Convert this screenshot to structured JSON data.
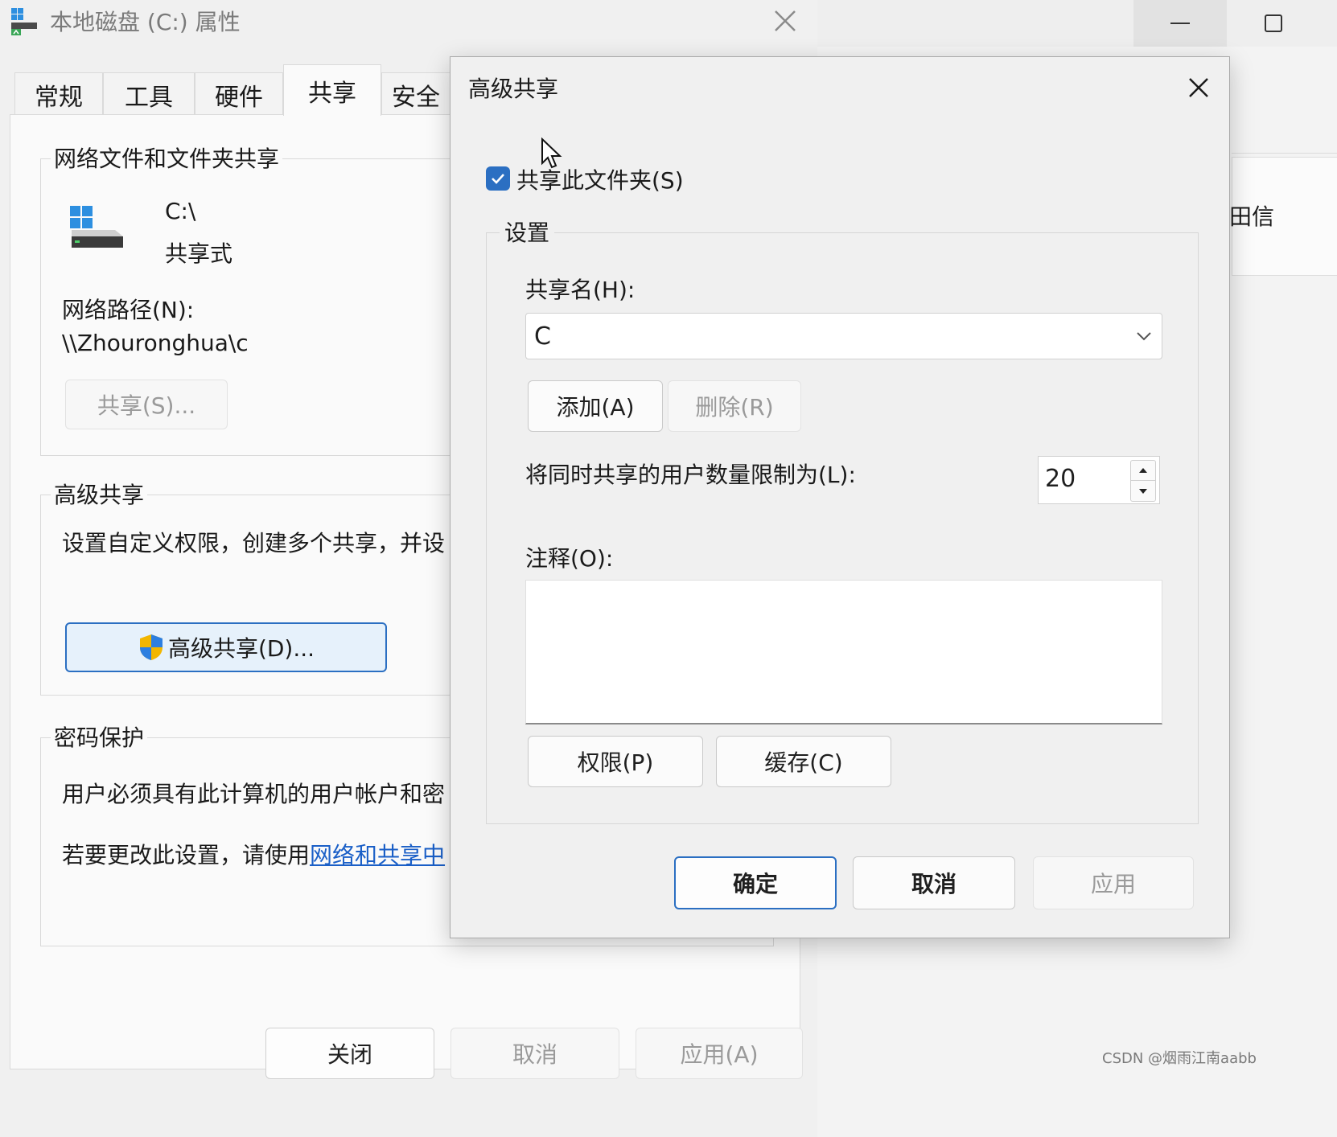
{
  "properties_window": {
    "title": "本地磁盘 (C:) 属性",
    "tabs": [
      {
        "label": "常规"
      },
      {
        "label": "工具"
      },
      {
        "label": "硬件"
      },
      {
        "label": "共享",
        "active": true
      },
      {
        "label": "安全"
      }
    ],
    "network_sharing": {
      "group_title": "网络文件和文件夹共享",
      "drive_name": "C:\\",
      "status": "共享式",
      "network_path_label": "网络路径(N):",
      "network_path_value": "\\\\Zhouronghua\\c",
      "share_button": "共享(S)..."
    },
    "advanced_sharing_group": {
      "group_title": "高级共享",
      "description": "设置自定义权限，创建多个共享，并设",
      "button": "高级共享(D)..."
    },
    "password_protection": {
      "group_title": "密码保护",
      "line1": "用户必须具有此计算机的用户帐户和密",
      "line2_prefix": "若要更改此设置，请使用",
      "line2_link": "网络和共享中"
    },
    "footer": {
      "close": "关闭",
      "cancel": "取消",
      "apply": "应用(A)"
    }
  },
  "background_window": {
    "panel_text": "田信"
  },
  "advanced_dialog": {
    "title": "高级共享",
    "share_checkbox_label": "共享此文件夹(S)",
    "share_checkbox_checked": true,
    "settings_title": "设置",
    "share_name_label": "共享名(H):",
    "share_name_value": "C",
    "add_button": "添加(A)",
    "remove_button": "删除(R)",
    "user_limit_label": "将同时共享的用户数量限制为(L):",
    "user_limit_value": "20",
    "comment_label": "注释(O):",
    "comment_value": "",
    "permissions_button": "权限(P)",
    "caching_button": "缓存(C)",
    "ok_button": "确定",
    "cancel_button": "取消",
    "apply_button": "应用"
  },
  "watermark": "CSDN @烟雨江南aabb",
  "colors": {
    "accent": "#2b6fc2",
    "link": "#1a5fc7"
  }
}
